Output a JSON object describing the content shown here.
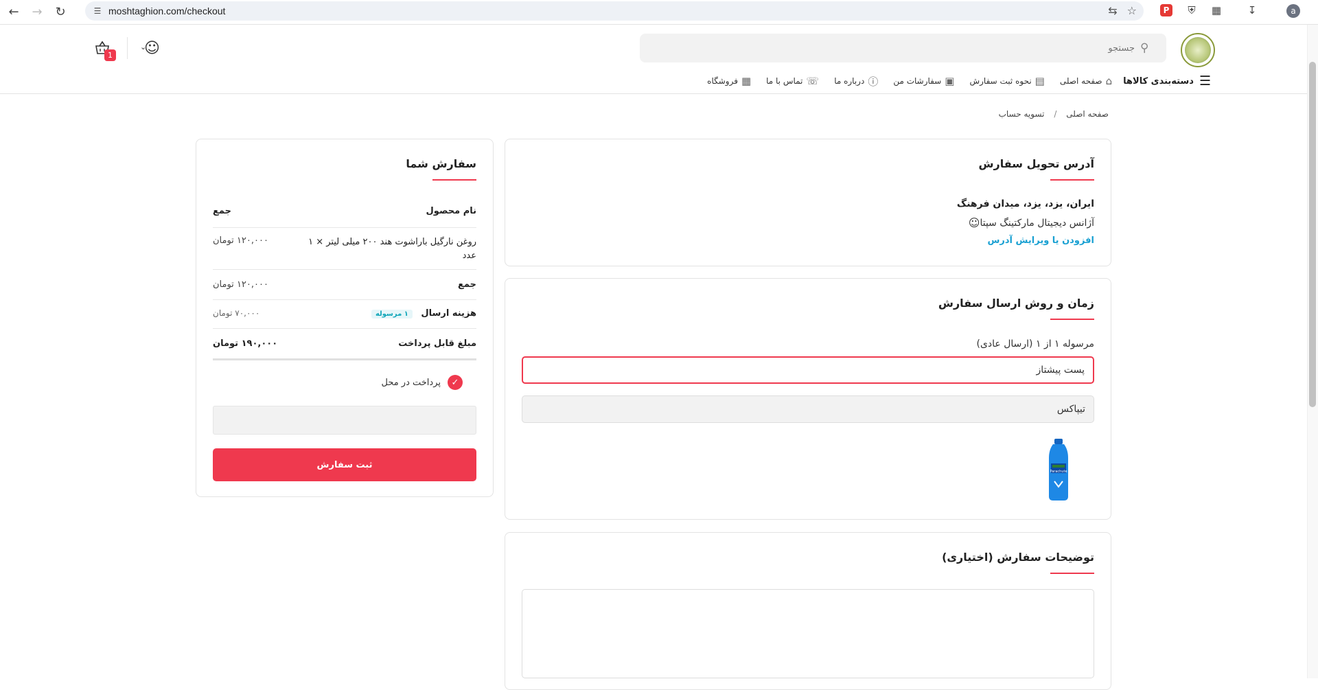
{
  "browser": {
    "url": "moshtaghion.com/checkout",
    "profile_initial": "a"
  },
  "header": {
    "search_placeholder": "جستجو",
    "cart_count": "1",
    "menu": {
      "categories": "دسته‌بندی کالاها",
      "items": [
        "صفحه اصلی",
        "نحوه ثبت سفارش",
        "سفارشات من",
        "درباره ما",
        "تماس با ما",
        "فروشگاه"
      ]
    }
  },
  "breadcrumb": {
    "home": "صفحه اصلی",
    "separator": "/",
    "current": "تسویه حساب"
  },
  "address": {
    "title": "آدرس تحویل سفارش",
    "line": "ایران، یزد، یزد، میدان فرهنگ",
    "recipient": "آژانس دیجیتال مارکتینگ سپتا",
    "edit_link": "افزودن یا ویرایش آدرس"
  },
  "shipping": {
    "title": "زمان و روش ارسال سفارش",
    "subtitle": "مرسوله ۱ از ۱ (ارسال عادی)",
    "option_selected": "پست پیشتاز",
    "option_other": "تیپاکس",
    "product_label": "Parachute"
  },
  "notes": {
    "title": "توضیحات سفارش (اختیاری)"
  },
  "summary": {
    "title": "سفارش شما",
    "col_product": "نام محصول",
    "col_total": "جمع",
    "item_name": "روغن نارگیل باراشوت هند ۲۰۰ میلی لیتر × ۱ عدد",
    "item_price": "۱۲۰,۰۰۰ تومان",
    "subtotal_label": "جمع",
    "subtotal_value": "۱۲۰,۰۰۰ تومان",
    "shipping_label": "هزینه ارسال",
    "shipping_tag": "۱ مرسوله",
    "shipping_value": "۷۰,۰۰۰ تومان",
    "payable_label": "مبلغ قابل پرداخت",
    "payable_value": "۱۹۰,۰۰۰ تومان",
    "payment_method": "پرداخت در محل",
    "submit_label": "ثبت سفارش"
  },
  "colors": {
    "accent": "#ef394e",
    "link": "#19a0d2"
  }
}
